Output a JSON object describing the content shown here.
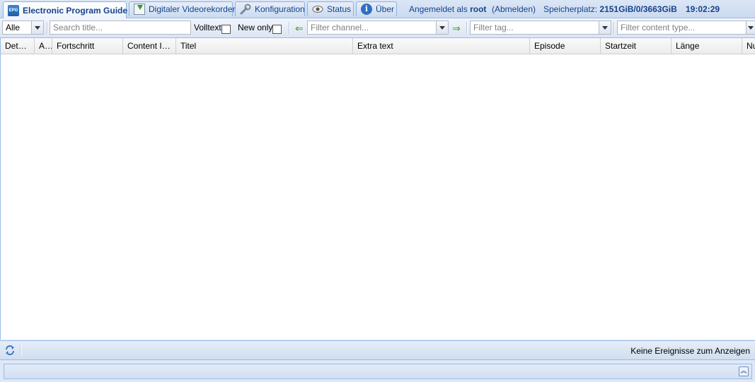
{
  "tabs": [
    {
      "label": "Electronic Program Guide",
      "icon": "epg-icon",
      "icon_text": "EPG"
    },
    {
      "label": "Digitaler Videorekorder",
      "icon": "download-icon"
    },
    {
      "label": "Konfiguration",
      "icon": "wrench-icon"
    },
    {
      "label": "Status",
      "icon": "eye-icon"
    },
    {
      "label": "Über",
      "icon": "info-icon",
      "icon_text": "i"
    }
  ],
  "header": {
    "logged_in_prefix": "Angemeldet als",
    "user": "root",
    "logout": "(Abmelden)",
    "storage_prefix": "Speicherplatz:",
    "storage_value": "2151GiB/0/3663GiB",
    "clock": "19:02:29"
  },
  "toolbar": {
    "filter_select_value": "Alle",
    "search_placeholder": "Search title...",
    "fulltext_label": "Volltext",
    "new_only_label": "New only",
    "channel_placeholder": "Filter channel...",
    "tag_placeholder": "Filter tag...",
    "content_type_placeholder": "Filter content type..."
  },
  "columns": [
    "Details",
    "A...",
    "Fortschritt",
    "Content Ic...",
    "Titel",
    "Extra text",
    "Episode",
    "Startzeit",
    "Länge",
    "Nu"
  ],
  "paging": {
    "message": "Keine Ereignisse zum Anzeigen"
  },
  "bottom": {
    "collapse_glyph": "︽"
  },
  "colors": {
    "accent": "#15428b",
    "border": "#99bbe8"
  }
}
